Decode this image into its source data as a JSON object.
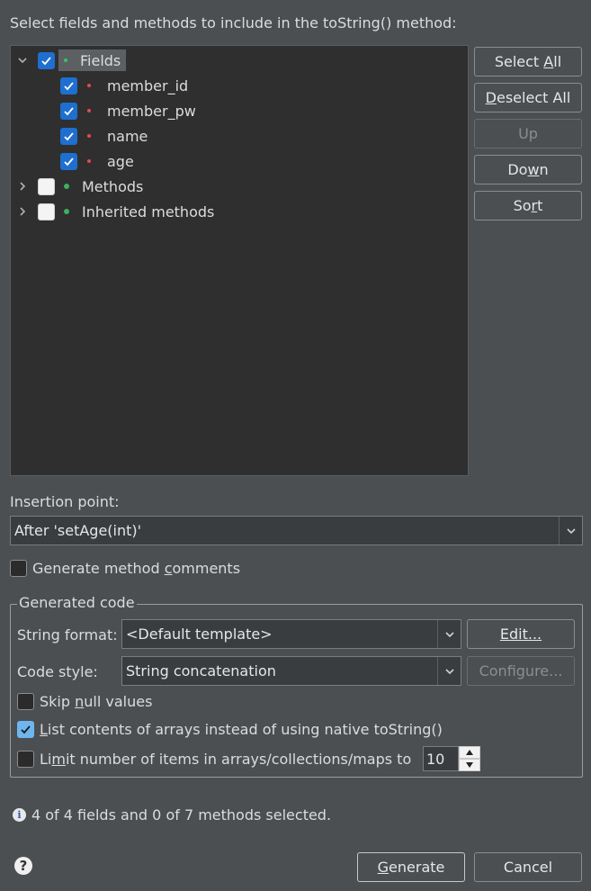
{
  "header": {
    "instruction": "Select fields and methods to include in the toString() method:"
  },
  "tree": {
    "fields": {
      "label": "Fields",
      "items": [
        "member_id",
        "member_pw",
        "name",
        "age"
      ]
    },
    "methods_label": "Methods",
    "inherited_label": "Inherited methods"
  },
  "buttons": {
    "select_all": {
      "pre": "Select ",
      "key": "A",
      "post": "ll"
    },
    "deselect_all": {
      "pre": "",
      "key": "D",
      "post": "eselect All"
    },
    "up": "Up",
    "down": {
      "pre": "Do",
      "key": "w",
      "post": "n"
    },
    "sort": {
      "pre": "So",
      "key": "r",
      "post": "t"
    }
  },
  "insertion": {
    "label": "Insertion point:",
    "value": "After 'setAge(int)'"
  },
  "comments": {
    "pre": "Generate method ",
    "key": "c",
    "post": "omments",
    "checked": false
  },
  "generated": {
    "legend": "Generated code",
    "string_format_label": "String format:",
    "string_format_value": "<Default template>",
    "edit_button": "Edit...",
    "code_style_label": "Code style:",
    "code_style_value": "String concatenation",
    "configure_button": "Configure...",
    "skip_null": {
      "pre": "Skip ",
      "key": "n",
      "post": "ull values",
      "checked": false
    },
    "list_contents": {
      "pre": "",
      "key": "L",
      "post": "ist contents of arrays instead of using native toString()",
      "checked": true
    },
    "limit": {
      "pre": "Li",
      "key": "m",
      "post": "it number of items in arrays/collections/maps to",
      "checked": false,
      "value": "10"
    }
  },
  "status": {
    "text": "4 of 4 fields and 0 of 7 methods selected."
  },
  "footer": {
    "generate": {
      "key": "G",
      "post": "enerate"
    },
    "cancel": "Cancel"
  }
}
